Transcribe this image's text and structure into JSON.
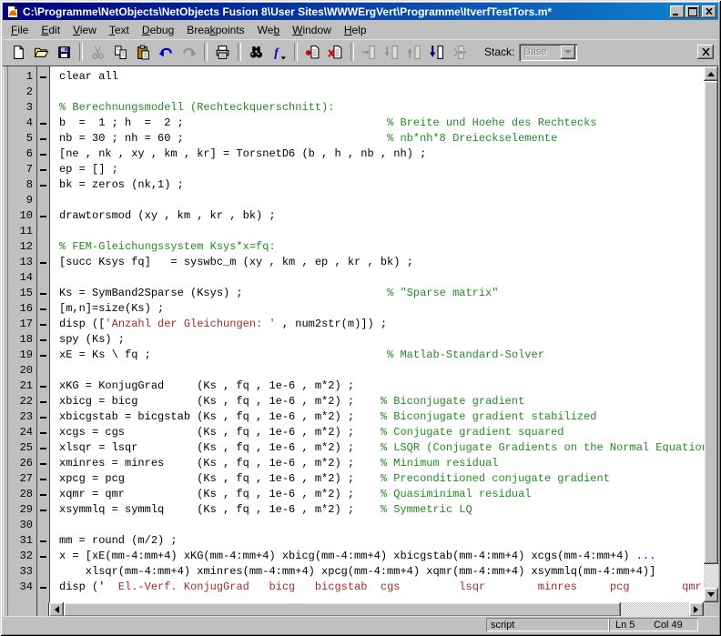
{
  "window": {
    "title": "C:\\Programme\\NetObjects\\NetObjects Fusion 8\\User Sites\\WWWErgVert\\Programme\\ItverfTestTors.m*"
  },
  "menu_bar": {
    "items": [
      {
        "label": "File",
        "underline": 0
      },
      {
        "label": "Edit",
        "underline": 0
      },
      {
        "label": "View",
        "underline": 0
      },
      {
        "label": "Text",
        "underline": 0
      },
      {
        "label": "Debug",
        "underline": 0
      },
      {
        "label": "Breakpoints",
        "underline": 4
      },
      {
        "label": "Web",
        "underline": 2
      },
      {
        "label": "Window",
        "underline": 0
      },
      {
        "label": "Help",
        "underline": 0
      }
    ]
  },
  "toolbar": {
    "groups": [
      {
        "buttons": [
          {
            "name": "new-file",
            "icon": "new",
            "disabled": false
          },
          {
            "name": "open-file",
            "icon": "open",
            "disabled": false
          },
          {
            "name": "save-file",
            "icon": "save",
            "disabled": false
          }
        ]
      },
      {
        "buttons": [
          {
            "name": "cut",
            "icon": "cut",
            "disabled": true
          },
          {
            "name": "copy",
            "icon": "copy",
            "disabled": false
          },
          {
            "name": "paste",
            "icon": "paste",
            "disabled": false
          },
          {
            "name": "undo",
            "icon": "undo",
            "disabled": false
          },
          {
            "name": "redo",
            "icon": "redo",
            "disabled": true
          }
        ]
      },
      {
        "buttons": [
          {
            "name": "print",
            "icon": "print",
            "disabled": false
          }
        ]
      },
      {
        "buttons": [
          {
            "name": "find",
            "icon": "find",
            "disabled": false
          },
          {
            "name": "function-list",
            "icon": "fn",
            "disabled": false
          }
        ]
      },
      {
        "buttons": [
          {
            "name": "set-clear-breakpoint",
            "icon": "bpset",
            "disabled": false
          },
          {
            "name": "clear-all-breakpoints",
            "icon": "bpclear",
            "disabled": false
          }
        ]
      },
      {
        "buttons": [
          {
            "name": "step",
            "icon": "step",
            "disabled": true
          },
          {
            "name": "step-in",
            "icon": "stepin",
            "disabled": true
          },
          {
            "name": "step-out",
            "icon": "stepout",
            "disabled": true
          },
          {
            "name": "run-continue",
            "icon": "run",
            "disabled": false
          },
          {
            "name": "quit-debug",
            "icon": "quit",
            "disabled": true
          }
        ]
      }
    ],
    "stack_label": "Stack:",
    "stack_value": "Base",
    "stack_disabled": true
  },
  "editor": {
    "lines": [
      {
        "n": 1,
        "bp": true,
        "seg": [
          [
            "t",
            "clear all"
          ]
        ]
      },
      {
        "n": 2,
        "bp": false,
        "seg": []
      },
      {
        "n": 3,
        "bp": false,
        "seg": [
          [
            "c",
            "% Berechnungsmodell (Rechteckquerschnitt):"
          ]
        ]
      },
      {
        "n": 4,
        "bp": true,
        "seg": [
          [
            "t",
            "b  =  1 ; h  =  2 ;                               "
          ],
          [
            "c",
            "% Breite und Hoehe des Rechtecks"
          ]
        ]
      },
      {
        "n": 5,
        "bp": true,
        "seg": [
          [
            "t",
            "nb = 30 ; nh = 60 ;                               "
          ],
          [
            "c",
            "% nb*nh*8 Dreieckselemente"
          ]
        ]
      },
      {
        "n": 6,
        "bp": true,
        "seg": [
          [
            "t",
            "[ne , nk , xy , km , kr] = TorsnetD6 (b , h , nb , nh) ;"
          ]
        ]
      },
      {
        "n": 7,
        "bp": true,
        "seg": [
          [
            "t",
            "ep = [] ;"
          ]
        ]
      },
      {
        "n": 8,
        "bp": true,
        "seg": [
          [
            "t",
            "bk = zeros (nk,1) ;"
          ]
        ]
      },
      {
        "n": 9,
        "bp": false,
        "seg": []
      },
      {
        "n": 10,
        "bp": true,
        "seg": [
          [
            "t",
            "drawtorsmod (xy , km , kr , bk) ;"
          ]
        ]
      },
      {
        "n": 11,
        "bp": false,
        "seg": []
      },
      {
        "n": 12,
        "bp": false,
        "seg": [
          [
            "c",
            "% FEM-Gleichungssystem Ksys*x=fq:"
          ]
        ]
      },
      {
        "n": 13,
        "bp": true,
        "seg": [
          [
            "t",
            "[succ Ksys fq]   = syswbc_m (xy , km , ep , kr , bk) ;"
          ]
        ]
      },
      {
        "n": 14,
        "bp": false,
        "seg": []
      },
      {
        "n": 15,
        "bp": true,
        "seg": [
          [
            "t",
            "Ks = SymBand2Sparse (Ksys) ;                      "
          ],
          [
            "c",
            "% \"Sparse matrix\""
          ]
        ]
      },
      {
        "n": 16,
        "bp": true,
        "seg": [
          [
            "t",
            "[m,n]=size(Ks) ;"
          ]
        ]
      },
      {
        "n": 17,
        "bp": true,
        "seg": [
          [
            "t",
            "disp (["
          ],
          [
            "s",
            "'Anzahl der Gleichungen: '"
          ],
          [
            "t",
            " , num2str(m)]) ;"
          ]
        ]
      },
      {
        "n": 18,
        "bp": true,
        "seg": [
          [
            "t",
            "spy (Ks) ;"
          ]
        ]
      },
      {
        "n": 19,
        "bp": true,
        "seg": [
          [
            "t",
            "xE = Ks \\ fq ;                                    "
          ],
          [
            "c",
            "% Matlab-Standard-Solver"
          ]
        ]
      },
      {
        "n": 20,
        "bp": false,
        "seg": []
      },
      {
        "n": 21,
        "bp": true,
        "seg": [
          [
            "t",
            "xKG = KonjugGrad     (Ks , fq , 1e-6 , m*2) ;"
          ]
        ]
      },
      {
        "n": 22,
        "bp": true,
        "seg": [
          [
            "t",
            "xbicg = bicg         (Ks , fq , 1e-6 , m*2) ;    "
          ],
          [
            "c",
            "% Biconjugate gradient"
          ]
        ]
      },
      {
        "n": 23,
        "bp": true,
        "seg": [
          [
            "t",
            "xbicgstab = bicgstab (Ks , fq , 1e-6 , m*2) ;    "
          ],
          [
            "c",
            "% Biconjugate gradient stabilized"
          ]
        ]
      },
      {
        "n": 24,
        "bp": true,
        "seg": [
          [
            "t",
            "xcgs = cgs           (Ks , fq , 1e-6 , m*2) ;    "
          ],
          [
            "c",
            "% Conjugate gradient squared"
          ]
        ]
      },
      {
        "n": 25,
        "bp": true,
        "seg": [
          [
            "t",
            "xlsqr = lsqr         (Ks , fq , 1e-6 , m*2) ;    "
          ],
          [
            "c",
            "% LSQR (Conjugate Gradients on the Normal Equations)"
          ]
        ]
      },
      {
        "n": 26,
        "bp": true,
        "seg": [
          [
            "t",
            "xminres = minres     (Ks , fq , 1e-6 , m*2) ;    "
          ],
          [
            "c",
            "% Minimum residual"
          ]
        ]
      },
      {
        "n": 27,
        "bp": true,
        "seg": [
          [
            "t",
            "xpcg = pcg           (Ks , fq , 1e-6 , m*2) ;    "
          ],
          [
            "c",
            "% Preconditioned conjugate gradient"
          ]
        ]
      },
      {
        "n": 28,
        "bp": true,
        "seg": [
          [
            "t",
            "xqmr = qmr           (Ks , fq , 1e-6 , m*2) ;    "
          ],
          [
            "c",
            "% Quasiminimal residual"
          ]
        ]
      },
      {
        "n": 29,
        "bp": true,
        "seg": [
          [
            "t",
            "xsymmlq = symmlq     (Ks , fq , 1e-6 , m*2) ;    "
          ],
          [
            "c",
            "% Symmetric LQ"
          ]
        ]
      },
      {
        "n": 30,
        "bp": false,
        "seg": []
      },
      {
        "n": 31,
        "bp": true,
        "seg": [
          [
            "t",
            "mm = round (m/2) ;"
          ]
        ]
      },
      {
        "n": 32,
        "bp": true,
        "seg": [
          [
            "t",
            "x = [xE(mm-4:mm+4) xKG(mm-4:mm+4) xbicg(mm-4:mm+4) xbicgstab(mm-4:mm+4) xcgs(mm-4:mm+4) "
          ],
          [
            "b",
            "..."
          ]
        ]
      },
      {
        "n": 33,
        "bp": false,
        "seg": [
          [
            "t",
            "    xlsqr(mm-4:mm+4) xminres(mm-4:mm+4) xpcg(mm-4:mm+4) xqmr(mm-4:mm+4) xsymmlq(mm-4:mm+4)]"
          ]
        ]
      },
      {
        "n": 34,
        "bp": true,
        "seg": [
          [
            "t",
            "disp ('"
          ],
          [
            "s",
            "  El.-Verf. KonjugGrad   bicg   bicgstab  cgs         lsqr        minres     pcg        qmr"
          ]
        ]
      }
    ]
  },
  "status_bar": {
    "file_type": "script",
    "line_indicator": "Ln 5",
    "col_indicator": "Col 49"
  },
  "colors": {
    "comment": "#228B22",
    "string": "#A52A2A",
    "continuation": "#0000EE",
    "title_gradient_left": "#000080",
    "title_gradient_right": "#1084D0",
    "chrome": "#C0C0C0"
  }
}
